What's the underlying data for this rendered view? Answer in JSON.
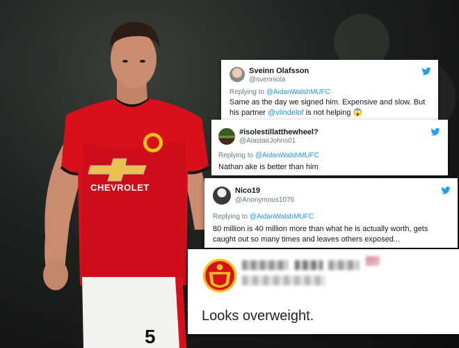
{
  "photo": {
    "shirt_sponsor": "CHEVROLET",
    "shirt_number": "5",
    "colors": {
      "shirt": "#d7101c",
      "shorts": "#f4f2ef",
      "background": "#1a1d1b"
    }
  },
  "tweets": [
    {
      "name": "Sveinn Olafsson",
      "handle": "@svenniola",
      "replying_prefix": "Replying to ",
      "replying_to": "@AidanWalshMUFC",
      "text_before": "Same as the day we signed him. Expensive and slow. But his partner ",
      "mention": "@vlindelof",
      "text_after": " is not helping ",
      "emoji": "😱"
    },
    {
      "name": "#isolestillatthewheel?",
      "handle": "@AlastairJohns01",
      "replying_prefix": "Replying to ",
      "replying_to": "@AidanWalshMUFC",
      "text": "Nathan ake is better than him"
    },
    {
      "name": "Nico19",
      "handle": "@Anonymous1076",
      "replying_prefix": "Replying to ",
      "replying_to": "@AidanWalshMUFC",
      "text": "80 million is 40 million more than what he is actually worth, gets caught out so many times and leaves others exposed..."
    },
    {
      "text": "Looks overweight."
    }
  ],
  "icons": {
    "twitter": "twitter-bird-icon",
    "club": "man-utd-crest-icon"
  },
  "accent": "#1da1f2"
}
